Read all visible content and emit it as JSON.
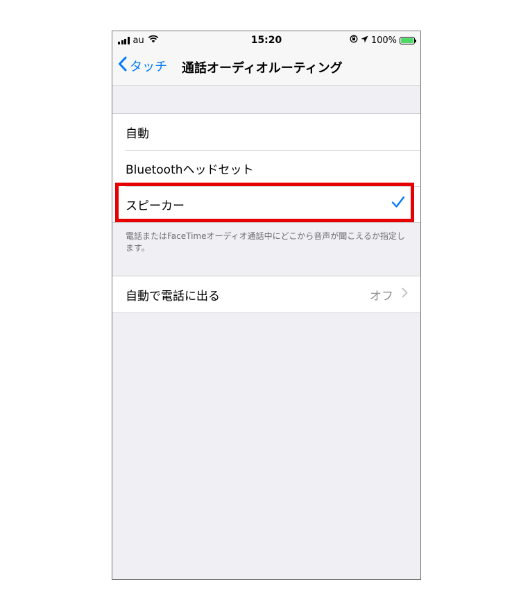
{
  "status_bar": {
    "carrier": "au",
    "time": "15:20",
    "battery_percent": "100%"
  },
  "nav": {
    "back_label": "タッチ",
    "title": "通話オーディオルーティング"
  },
  "routing_options": [
    {
      "label": "自動",
      "selected": false
    },
    {
      "label": "Bluetoothヘッドセット",
      "selected": false
    },
    {
      "label": "スピーカー",
      "selected": true
    }
  ],
  "routing_footnote": "電話またはFaceTimeオーディオ通話中にどこから音声が聞こえるか指定します。",
  "auto_answer": {
    "label": "自動で電話に出る",
    "value": "オフ"
  },
  "colors": {
    "accent": "#007aff",
    "highlight": "#e60000",
    "background": "#efeff4"
  },
  "icons": [
    "signal-icon",
    "wifi-icon",
    "orientation-lock-icon",
    "location-icon",
    "battery-icon",
    "chevron-left-icon",
    "checkmark-icon",
    "chevron-right-icon"
  ]
}
